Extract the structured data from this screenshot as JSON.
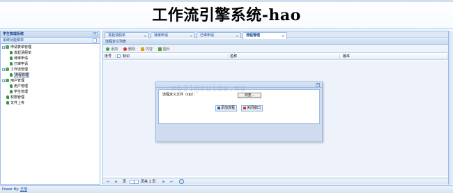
{
  "header": {
    "title": "工作流引擎系统-hao"
  },
  "left_panel": {
    "title": "学生管理系统",
    "collapse_icon": "«",
    "menu_title": "系统功能菜单",
    "tree": [
      {
        "label": "申请表单管理",
        "type": "folder",
        "expanded": true,
        "level": 0
      },
      {
        "label": "发起请假单",
        "type": "leaf",
        "level": 1
      },
      {
        "label": "待审申请",
        "type": "leaf",
        "level": 1
      },
      {
        "label": "已审申请",
        "type": "leaf",
        "level": 1
      },
      {
        "label": "工作流管理",
        "type": "folder",
        "expanded": true,
        "level": 0
      },
      {
        "label": "流程管理",
        "type": "leaf",
        "level": 1,
        "selected": true
      },
      {
        "label": "用户管理",
        "type": "folder",
        "expanded": true,
        "level": 0
      },
      {
        "label": "用户管理",
        "type": "leaf",
        "level": 1
      },
      {
        "label": "学生管理",
        "type": "leaf",
        "level": 1
      },
      {
        "label": "权限管理",
        "type": "leaf",
        "level": 0
      },
      {
        "label": "文件上传",
        "type": "leaf",
        "level": 0
      }
    ]
  },
  "footer": {
    "prefix": "Power By:",
    "author": "王浩"
  },
  "tabs": [
    {
      "label": "发起请假单",
      "active": false
    },
    {
      "label": "待审申请",
      "active": false
    },
    {
      "label": "已审申请",
      "active": false
    },
    {
      "label": "流程管理",
      "active": true
    }
  ],
  "list": {
    "title": "流程定义列表",
    "toolbar": [
      {
        "label": "添加",
        "icon": "add-icon",
        "color": "#3aa34a"
      },
      {
        "label": "删除",
        "icon": "delete-icon",
        "color": "#d23a2a"
      },
      {
        "label": "内容",
        "icon": "content-icon",
        "color": "#e0a21c"
      },
      {
        "label": "图片",
        "icon": "image-icon",
        "color": "#5a9e3a"
      }
    ],
    "columns": [
      "序号",
      "标识",
      "名称",
      "版本"
    ]
  },
  "pager": {
    "page_label": "页",
    "page_value": "1",
    "total_label": "页共 1 页"
  },
  "dialog": {
    "file_label": "流程定义文件（zip）：",
    "browse_label": "浏览...",
    "add_label": "添加流程",
    "close_label": "关闭窗口"
  },
  "watermark": "mb21@zuida.ma",
  "colors": {
    "accent": "#99bbe8",
    "header_text": "#000000",
    "panel_text": "#15428b"
  }
}
